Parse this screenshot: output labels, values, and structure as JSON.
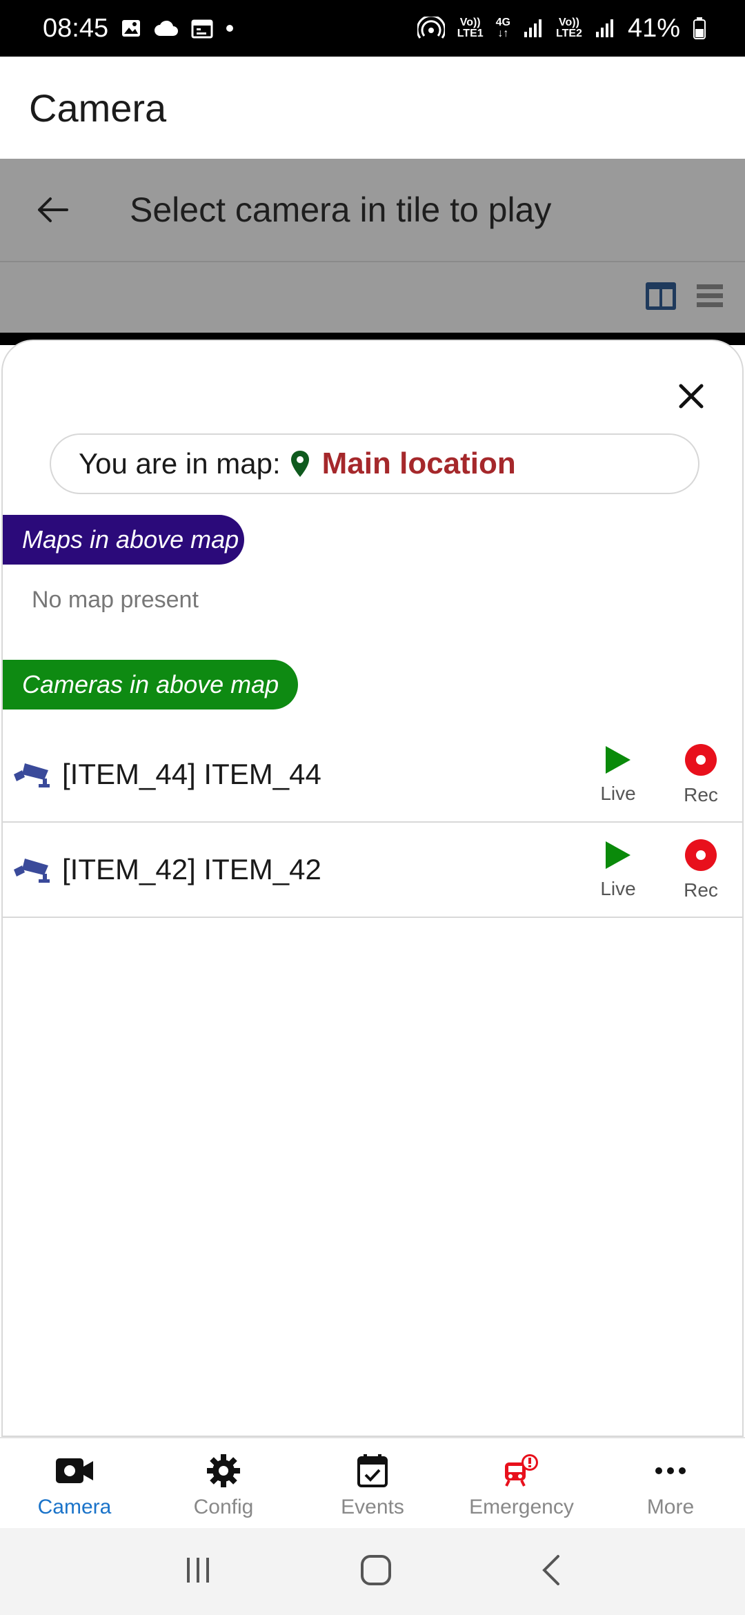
{
  "status_bar": {
    "time": "08:45",
    "lte1_label": "LTE1",
    "lte2_label": "LTE2",
    "network": "4G",
    "battery": "41%"
  },
  "app_bar": {
    "title": "Camera"
  },
  "toolbar": {
    "title": "Select camera in tile to play"
  },
  "sheet": {
    "location_label": "You are in map:",
    "location_value": "Main location",
    "maps_section": "Maps in above map",
    "no_map_text": "No map present",
    "cameras_section": "Cameras in above map",
    "cameras": [
      {
        "label": "[ITEM_44] ITEM_44",
        "live": "Live",
        "rec": "Rec"
      },
      {
        "label": "[ITEM_42] ITEM_42",
        "live": "Live",
        "rec": "Rec"
      }
    ]
  },
  "bottom_nav": {
    "items": [
      {
        "label": "Camera",
        "icon": "camera-icon"
      },
      {
        "label": "Config",
        "icon": "gear-icon"
      },
      {
        "label": "Events",
        "icon": "calendar-check-icon"
      },
      {
        "label": "Emergency",
        "icon": "emergency-icon"
      },
      {
        "label": "More",
        "icon": "more-icon"
      }
    ]
  },
  "colors": {
    "location_value": "#a5282b",
    "maps_tag": "#2b0a7a",
    "cameras_tag": "#0e8a12",
    "live": "#0a8a0a",
    "rec": "#e8101c",
    "active_nav": "#1a73c9",
    "cctv_icon": "#3a4a9a"
  }
}
